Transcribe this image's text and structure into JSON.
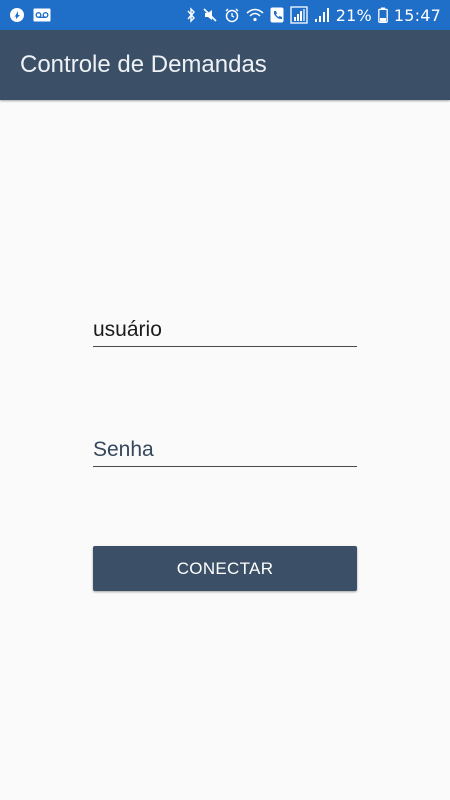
{
  "status_bar": {
    "battery_percent": "21%",
    "time": "15:47",
    "icons_left": [
      "notification-app-icon",
      "voicemail-icon"
    ],
    "icons_right": [
      "bluetooth-icon",
      "mute-icon",
      "alarm-icon",
      "wifi-icon",
      "phone-call-icon",
      "sim-signal-icon",
      "signal-strength-icon",
      "battery-icon"
    ]
  },
  "app_bar": {
    "title": "Controle de Demandas",
    "background": "#3b4f66"
  },
  "login": {
    "username_value": "usuário",
    "password_placeholder": "Senha",
    "connect_label": "CONECTAR"
  },
  "colors": {
    "status_bar": "#1f6fc9",
    "primary": "#3b4f66",
    "background": "#fafafa"
  }
}
